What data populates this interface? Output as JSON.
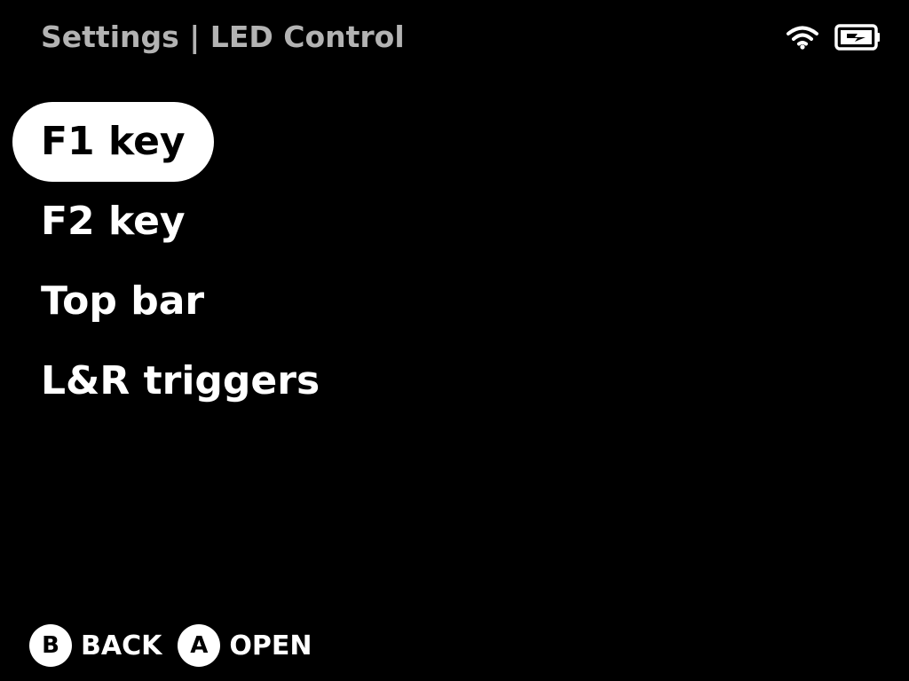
{
  "header": {
    "title": "Settings | LED Control",
    "status_icons": [
      "wifi-icon",
      "battery-charging-icon"
    ]
  },
  "menu": {
    "items": [
      {
        "label": "F1 key",
        "selected": true
      },
      {
        "label": "F2 key",
        "selected": false
      },
      {
        "label": "Top bar",
        "selected": false
      },
      {
        "label": "L&R triggers",
        "selected": false
      }
    ]
  },
  "hints": [
    {
      "button": "B",
      "label": "BACK"
    },
    {
      "button": "A",
      "label": "OPEN"
    }
  ],
  "colors": {
    "background": "#000000",
    "title": "#b3b3b3",
    "text": "#ffffff",
    "selection": "#ffffff",
    "selected_text": "#000000"
  }
}
